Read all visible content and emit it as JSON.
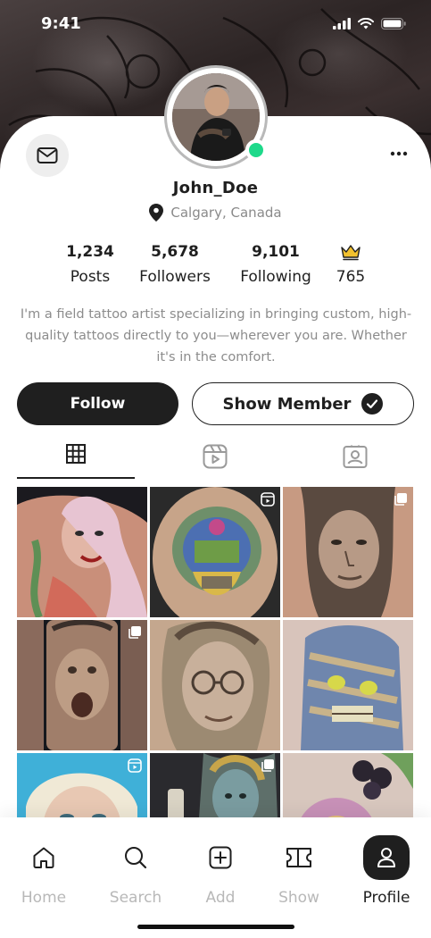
{
  "status_bar": {
    "time": "9:41"
  },
  "profile": {
    "username": "John_Doe",
    "location": "Calgary, Canada",
    "bio": "I'm a field tattoo artist specializing in bringing custom, high-quality tattoos directly to you—wherever you are. Whether it's in the comfort."
  },
  "stats": [
    {
      "value": "1,234",
      "label": "Posts"
    },
    {
      "value": "5,678",
      "label": "Followers"
    },
    {
      "value": "9,101",
      "label": "Following"
    },
    {
      "icon": "crown-icon",
      "label": "765"
    }
  ],
  "actions": {
    "follow_label": "Follow",
    "member_label": "Show Member"
  },
  "content_tabs": [
    {
      "icon": "grid-icon",
      "active": true
    },
    {
      "icon": "reels-icon",
      "active": false
    },
    {
      "icon": "tagged-icon",
      "active": false
    }
  ],
  "posts": [
    {
      "subject": "woman portrait tattoo",
      "badge": null
    },
    {
      "subject": "clan crest tattoo",
      "badge": "reel-icon"
    },
    {
      "subject": "man portrait tattoo",
      "badge": "multi-image-icon"
    },
    {
      "subject": "screaming man tattoo",
      "badge": "multi-image-icon"
    },
    {
      "subject": "glasses man tattoo",
      "badge": null
    },
    {
      "subject": "mummy tattoo",
      "badge": null
    },
    {
      "subject": "marilyn tattoo",
      "badge": "reel-icon"
    },
    {
      "subject": "woman face tattoo",
      "badge": "multi-image-icon"
    },
    {
      "subject": "flower tattoo",
      "badge": null
    }
  ],
  "bottom_nav": [
    {
      "label": "Home",
      "icon": "home-icon",
      "active": false
    },
    {
      "label": "Search",
      "icon": "search-icon",
      "active": false
    },
    {
      "label": "Add",
      "icon": "add-icon",
      "active": false
    },
    {
      "label": "Show",
      "icon": "ticket-icon",
      "active": false
    },
    {
      "label": "Profile",
      "icon": "user-icon",
      "active": true
    }
  ],
  "colors": {
    "primary": "#1f1f1f",
    "online": "#1ed98a",
    "crown": "#f2c12e",
    "muted_text": "#8c8c8c",
    "inactive_nav": "#b8b8b8"
  }
}
